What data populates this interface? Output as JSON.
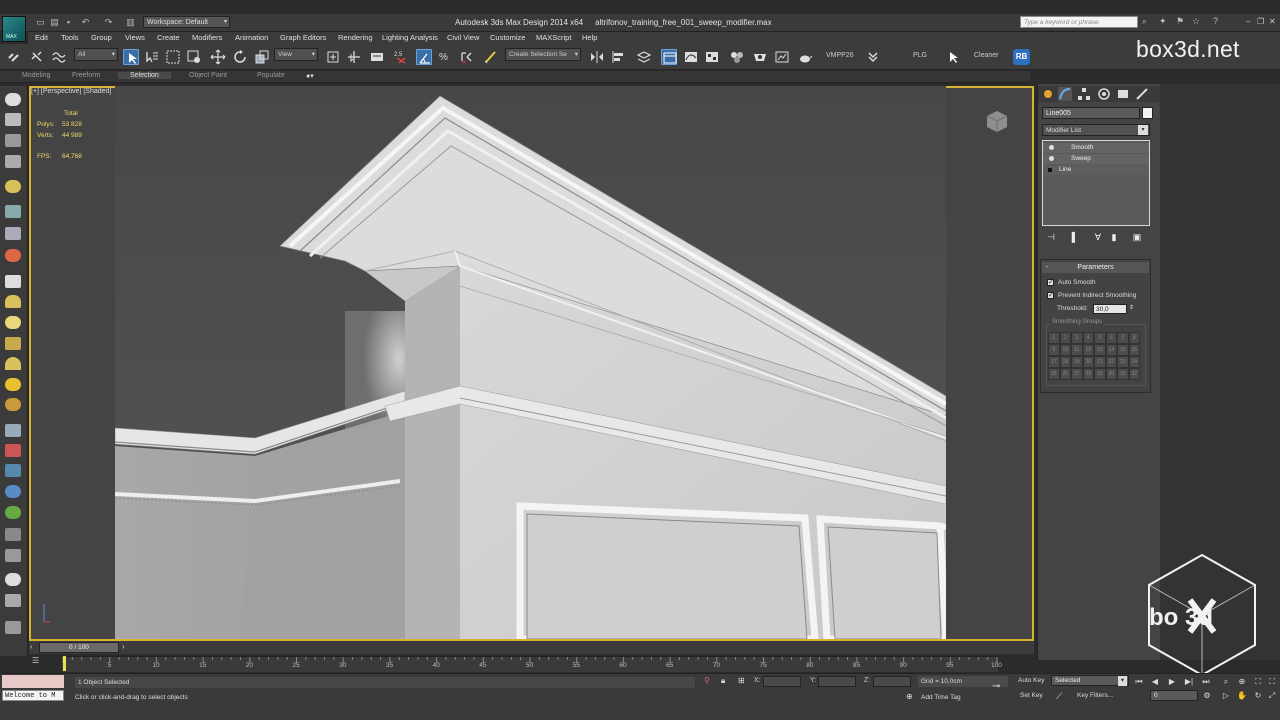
{
  "app": {
    "workspace": "Workspace: Default",
    "title": "Autodesk 3ds Max Design 2014 x64",
    "filename": "altrifonov_training_free_001_sweep_modifier.max",
    "search_placeholder": "Type a keyword or phrase",
    "logo_text": "MAX"
  },
  "menu": [
    "Edit",
    "Tools",
    "Group",
    "Views",
    "Create",
    "Modifiers",
    "Animation",
    "Graph Editors",
    "Rendering",
    "Lighting Analysis",
    "Civil View",
    "Customize",
    "MAXScript",
    "Help"
  ],
  "toolbar": {
    "selection_filter": "All",
    "ref_coord": "View",
    "snap_value": "2.5",
    "named_selection": "Create Selection Se",
    "vmpp": "VMPP26",
    "plg": "PLG",
    "cleaner": "Cleaner",
    "rb": "RB"
  },
  "brand": "box3d.net",
  "ribbon": [
    "Modeling",
    "Freeform",
    "Selection",
    "Object Paint",
    "Populate"
  ],
  "ribbon_active": "Selection",
  "viewport": {
    "label": "[+] [Perspective] [Shaded]",
    "stats_header": "Total",
    "stats": [
      {
        "k": "Polys:",
        "v": "53 828"
      },
      {
        "k": "Verts:",
        "v": "44 989"
      }
    ],
    "fps_k": "FPS:",
    "fps_v": "64,768"
  },
  "command_panel": {
    "object_name": "Line005",
    "object_color": "#f2f2f2",
    "modifier_list": "Modifier List",
    "stack": [
      "Smooth",
      "Sweep",
      "Line"
    ],
    "parameters_title": "Parameters",
    "auto_smooth": "Auto Smooth",
    "prevent": "Prevent Indirect Smoothing",
    "threshold_label": "Threshold:",
    "threshold_value": "30,0",
    "smoothing_groups": "Smoothing Groups",
    "sg": [
      "1",
      "2",
      "3",
      "4",
      "5",
      "6",
      "7",
      "8",
      "9",
      "10",
      "11",
      "12",
      "13",
      "14",
      "15",
      "16",
      "17",
      "18",
      "19",
      "20",
      "21",
      "22",
      "23",
      "24",
      "25",
      "26",
      "27",
      "28",
      "29",
      "30",
      "31",
      "32"
    ]
  },
  "timeline": {
    "slider": "0 / 100",
    "ticks": [
      "5",
      "10",
      "15",
      "20",
      "25",
      "30",
      "35",
      "40",
      "45",
      "50",
      "55",
      "60",
      "65",
      "70",
      "75",
      "80",
      "85",
      "90",
      "95",
      "100"
    ]
  },
  "status": {
    "welcome": "Welcome to M",
    "selected": "1 Object Selected",
    "prompt": "Click or click-and-drag to select objects",
    "x": "X:",
    "y": "Y:",
    "z": "Z:",
    "grid": "Grid = 10,0cm",
    "add_time_tag": "Add Time Tag",
    "auto_key": "Auto Key",
    "set_key": "Set Key",
    "selected_set": "Selected",
    "key_filters": "Key Filters...",
    "frame": "0"
  },
  "watermark": "bo 3d",
  "colors": {
    "active_border": "#d8b232",
    "accent": "#3a6ea8",
    "stats_text": "#f2d96a"
  }
}
